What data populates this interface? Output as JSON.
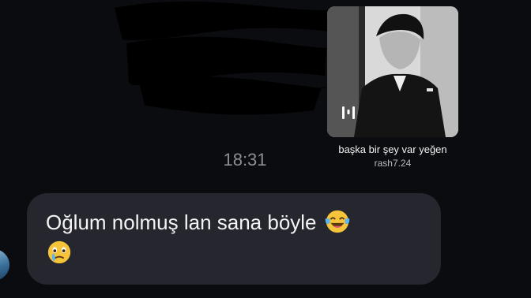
{
  "chat": {
    "shared_reel": {
      "caption": "başka bir şey var yeğen",
      "author": "rash7.24",
      "icon": "reels-icon"
    },
    "timestamp": "18:31",
    "incoming_message": {
      "text": "Oğlum nolmuş lan sana böyle",
      "emojis": [
        "face-with-tears-of-joy",
        "face-holding-back-tears"
      ]
    }
  },
  "colors": {
    "background": "#0b0c10",
    "bubble": "#25262e",
    "timestamp": "#8c8e95",
    "message_text": "#f4f4f5",
    "author_text": "#b9bbc2"
  }
}
